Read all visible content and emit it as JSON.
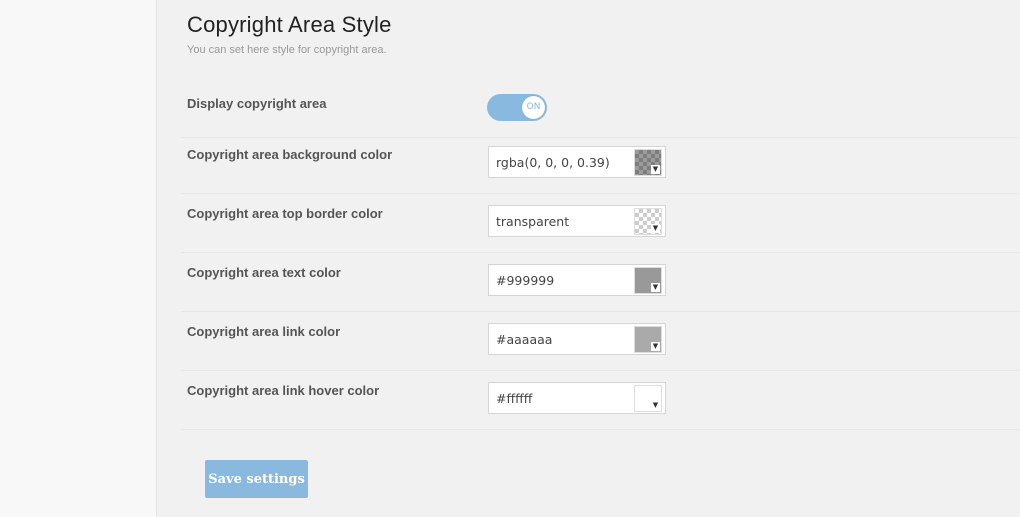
{
  "section": {
    "title": "Copyright Area Style",
    "description": "You can set here style for copyright area."
  },
  "display_row": {
    "label": "Display copyright area",
    "toggle_text": "ON"
  },
  "color_rows": [
    {
      "label": "Copyright area background color",
      "value": "rgba(0, 0, 0, 0.39)",
      "swatch_color": "rgba(0, 0, 0, 0.39)"
    },
    {
      "label": "Copyright area top border color",
      "value": "transparent",
      "swatch_color": "transparent"
    },
    {
      "label": "Copyright area text color",
      "value": "#999999",
      "swatch_color": "#999999"
    },
    {
      "label": "Copyright area link color",
      "value": "#aaaaaa",
      "swatch_color": "#aaaaaa"
    },
    {
      "label": "Copyright area link hover color",
      "value": "#ffffff",
      "swatch_color": "#ffffff"
    }
  ],
  "save_label": "Save settings",
  "colors": {
    "accent": "#8ab9e0",
    "background": "#f1f1f1",
    "sidebar": "#f8f8f8"
  },
  "icons": {
    "dropdown": "caret-down-icon"
  }
}
